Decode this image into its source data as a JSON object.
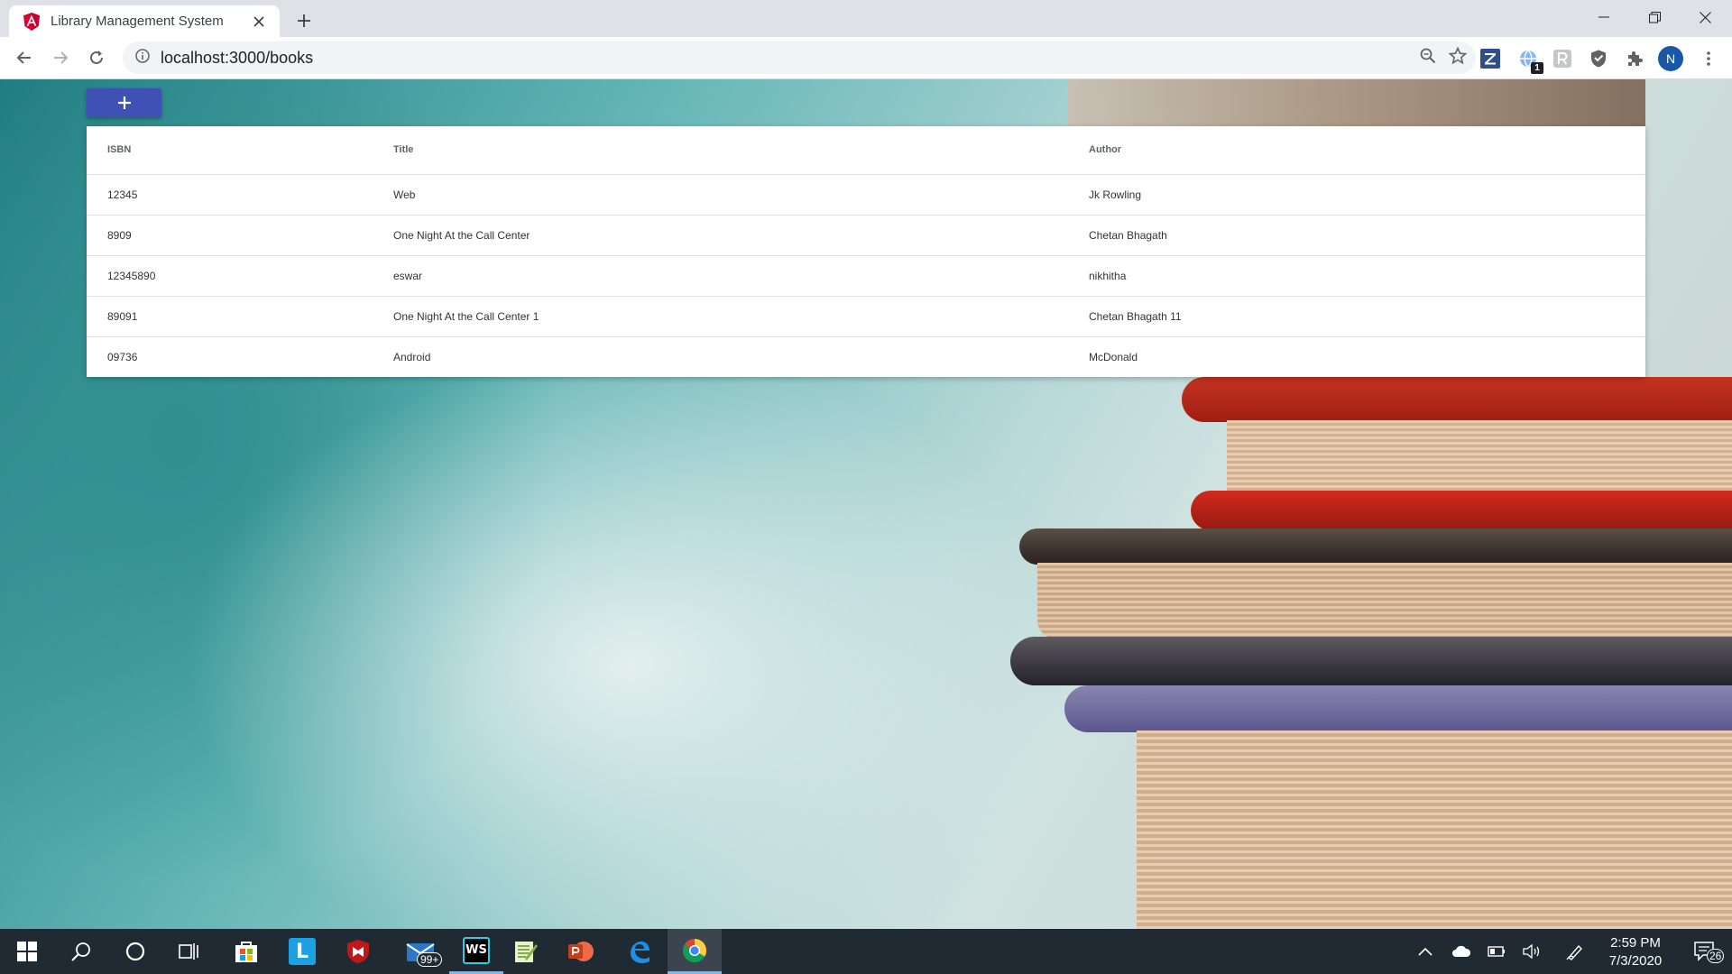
{
  "browser": {
    "tab_title": "Library Management System",
    "url": "localhost:3000/books",
    "profile_initial": "N",
    "extension_badge": "1"
  },
  "page": {
    "add_button_label": "+",
    "table": {
      "headers": [
        "ISBN",
        "Title",
        "Author"
      ],
      "rows": [
        {
          "isbn": "12345",
          "title": "Web",
          "author": "Jk Rowling"
        },
        {
          "isbn": "8909",
          "title": "One Night At the Call Center",
          "author": "Chetan Bhagath"
        },
        {
          "isbn": "12345890",
          "title": "eswar",
          "author": "nikhitha"
        },
        {
          "isbn": "89091",
          "title": "One Night At the Call Center 1",
          "author": "Chetan Bhagath 11"
        },
        {
          "isbn": "09736",
          "title": "Android",
          "author": "McDonald"
        }
      ]
    }
  },
  "taskbar": {
    "mail_badge": "99+",
    "time": "2:59 PM",
    "date": "7/3/2020",
    "notification_count": "26",
    "icons": [
      "windows-start-icon",
      "search-icon",
      "cortana-icon",
      "task-view-icon",
      "store-icon",
      "lync-icon",
      "mcafee-icon",
      "mail-icon",
      "webstorm-icon",
      "notepad-plus-icon",
      "powerpoint-icon",
      "edge-icon",
      "chrome-icon"
    ]
  },
  "colors": {
    "accent": "#3f51b5",
    "taskbar": "#1f2a33",
    "chrome_tabstrip": "#dee1e6"
  }
}
